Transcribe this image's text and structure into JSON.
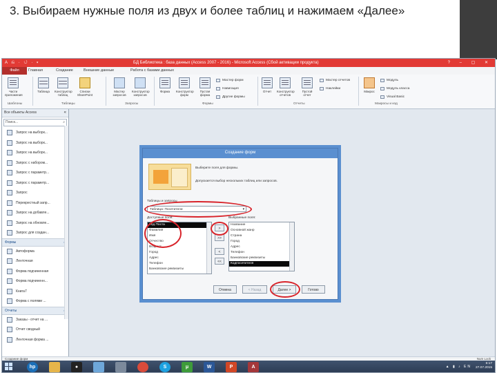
{
  "slide": {
    "title": "3. Выбираем нужные поля из двух и более таблиц и нажимаем «Далее»"
  },
  "app": {
    "window_title": "БД Библиотека : база данных (Access 2007 - 2016) - Microsoft Access (Сбой активации продукта)",
    "qat": "A ⎌ · ↺ · ▾",
    "window_buttons": "? – ▢ ✕",
    "tabs": [
      "Файл",
      "Главная",
      "Создание",
      "Внешние данные",
      "Работа с базами данных"
    ],
    "ribbon": {
      "groups": [
        "Шаблоны",
        "Таблицы",
        "Запросы",
        "Формы",
        "Отчеты",
        "Макросы и код"
      ],
      "buttons": {
        "app_parts": "Части приложения",
        "table": "Таблица",
        "table_design": "Конструктор таблиц",
        "sharepoint_lists": "Списки SharePoint",
        "query_wizard": "Мастер запросов",
        "query_design": "Конструктор запросов",
        "form": "Форма",
        "form_design": "Конструктор форм",
        "blank_form": "Пустая форма",
        "form_wizard": "Мастер форм",
        "navigation": "Навигация",
        "more_forms": "Другие формы",
        "report": "Отчет",
        "report_design": "Конструктор отчетов",
        "blank_report": "Пустой отчет",
        "report_wizard": "Мастер отчетов",
        "labels": "Наклейки",
        "macro": "Макрос",
        "module": "Модуль",
        "class_module": "Модуль класса",
        "visual_basic": "Visual Basic"
      }
    },
    "nav": {
      "header": "Все объекты Access",
      "search_placeholder": "Поиск...",
      "query_items": [
        "Запрос на выборк...",
        "Запрос на выборк...",
        "Запрос на выборк...",
        "Запрос с набором...",
        "Запрос с параметр...",
        "Запрос с параметр...",
        "Запрос",
        "Перекрестный запр...",
        "Запрос на добавле...",
        "Запрос на обновле...",
        "Запрос для создан..."
      ],
      "forms_section": "Формы",
      "form_items": [
        "Автоформа",
        "Ленточная",
        "Форма подчиненная",
        "Форма подчиненн...",
        "Книга7",
        "Форма с полями ..."
      ],
      "reports_section": "Отчеты",
      "report_items": [
        "Заказы - отчет на ...",
        "Отчет сводный",
        "Ленточная форма ..."
      ]
    },
    "dialog": {
      "title": "Создание форм",
      "heading": "Выберите поля для формы.",
      "hint": "Допускается выбор нескольких таблиц или запросов.",
      "tables_label": "Таблицы и запросы",
      "tables_value": "Таблица: Посетители",
      "available_label": "Доступные поля:",
      "selected_label": "Выбранные поля:",
      "available_fields": [
        "Код Поста",
        "Фамилия",
        "Имя",
        "Отчество",
        "Возраст",
        "Город",
        "Адрес",
        "Телефон",
        "Банковские реквизиты"
      ],
      "available_highlighted": 0,
      "selected_fields": [
        "Название",
        "Основной жанр",
        "Страна",
        "Город",
        "Адрес",
        "Телефон",
        "Банковские реквизиты",
        "Кодпосетителя"
      ],
      "selected_highlighted": 7,
      "move_buttons": [
        ">",
        ">>",
        "<",
        "<<"
      ],
      "buttons": {
        "cancel": "Отмена",
        "back": "< Назад",
        "next": "Далее >",
        "finish": "Готово"
      }
    },
    "status": {
      "left": "Создание форм",
      "right": "Num Lock"
    },
    "taskbar": {
      "icons": [
        "hp-icon",
        "folder-icon",
        "media-icon",
        "access-icon",
        "files-icon",
        "chrome-icon",
        "skype-icon",
        "torrent-icon",
        "word-icon",
        "powerpoint-icon",
        "access-icon-2"
      ],
      "tray": "EN",
      "time": "6:17",
      "date": "27.07.2015"
    }
  }
}
